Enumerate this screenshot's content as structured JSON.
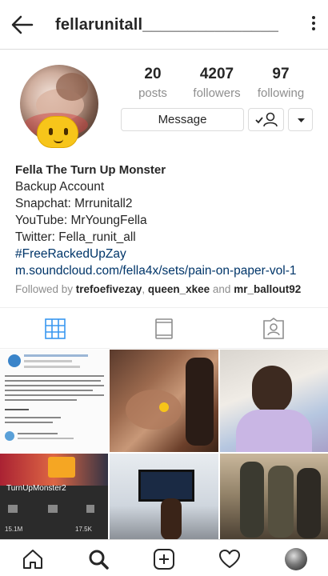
{
  "header": {
    "username": "fellarunitall_______________",
    "back_icon": "arrow-left-icon",
    "menu_icon": "vertical-dots-icon"
  },
  "stats": {
    "posts_count": "20",
    "posts_label": "posts",
    "followers_count": "4207",
    "followers_label": "followers",
    "following_count": "97",
    "following_label": "following"
  },
  "actions": {
    "message_label": "Message",
    "follow_icon": "user-check-icon",
    "dropdown_icon": "chevron-down-icon"
  },
  "bio": {
    "name": "Fella The Turn Up Monster",
    "line1": "Backup Account",
    "line2": "Snapchat: Mrrunitall2",
    "line3": "YouTube: MrYoungFella",
    "line4": "Twitter: Fella_runit_all",
    "hashtag": "#FreeRackedUpZay",
    "website": "m.soundcloud.com/fella4x/sets/pain-on-paper-vol-1",
    "followed_prefix": "Followed by ",
    "followed_user1": "trefoefivezay",
    "followed_sep": ", ",
    "followed_user2": "queen_xkee",
    "followed_and": " and ",
    "followed_user3": "mr_ballout92"
  },
  "tabs": [
    "grid-icon",
    "igtv-icon",
    "tagged-icon"
  ],
  "colors": {
    "active_tab": "#3897f0",
    "link": "#003569",
    "muted": "#8e8e8e",
    "border": "#dbdbdb"
  },
  "posts": {
    "post4_text": "TurnUpMonster2",
    "post4_stat1": "15.1M",
    "post4_stat2": "17.5K"
  },
  "bottom_nav": [
    "home-icon",
    "search-icon",
    "new-post-icon",
    "activity-heart-icon",
    "profile-avatar-icon"
  ]
}
